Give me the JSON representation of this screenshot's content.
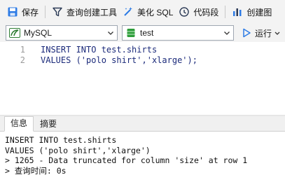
{
  "toolbar": {
    "save_label": "保存",
    "query_builder_label": "查询创建工具",
    "beautify_label": "美化 SQL",
    "snippet_label": "代码段",
    "create_chart_label": "创建图"
  },
  "selectors": {
    "connection": "MySQL",
    "database": "test",
    "run_label": "运行"
  },
  "editor": {
    "lines": [
      {
        "number": "1",
        "text": "INSERT INTO test.shirts"
      },
      {
        "number": "2",
        "text": "VALUES ('polo shirt','xlarge');"
      }
    ]
  },
  "result_tabs": [
    {
      "label": "信息",
      "active": true
    },
    {
      "label": "摘要",
      "active": false
    }
  ],
  "output": {
    "lines": [
      "INSERT INTO test.shirts",
      "VALUES ('polo shirt','xlarge')",
      "> 1265 - Data truncated for column 'size' at row 1",
      "> 查询时间: 0s"
    ]
  },
  "colors": {
    "accent_blue": "#2d7be5",
    "database_green": "#2e9d3a",
    "code_text": "#1b2a7a"
  }
}
